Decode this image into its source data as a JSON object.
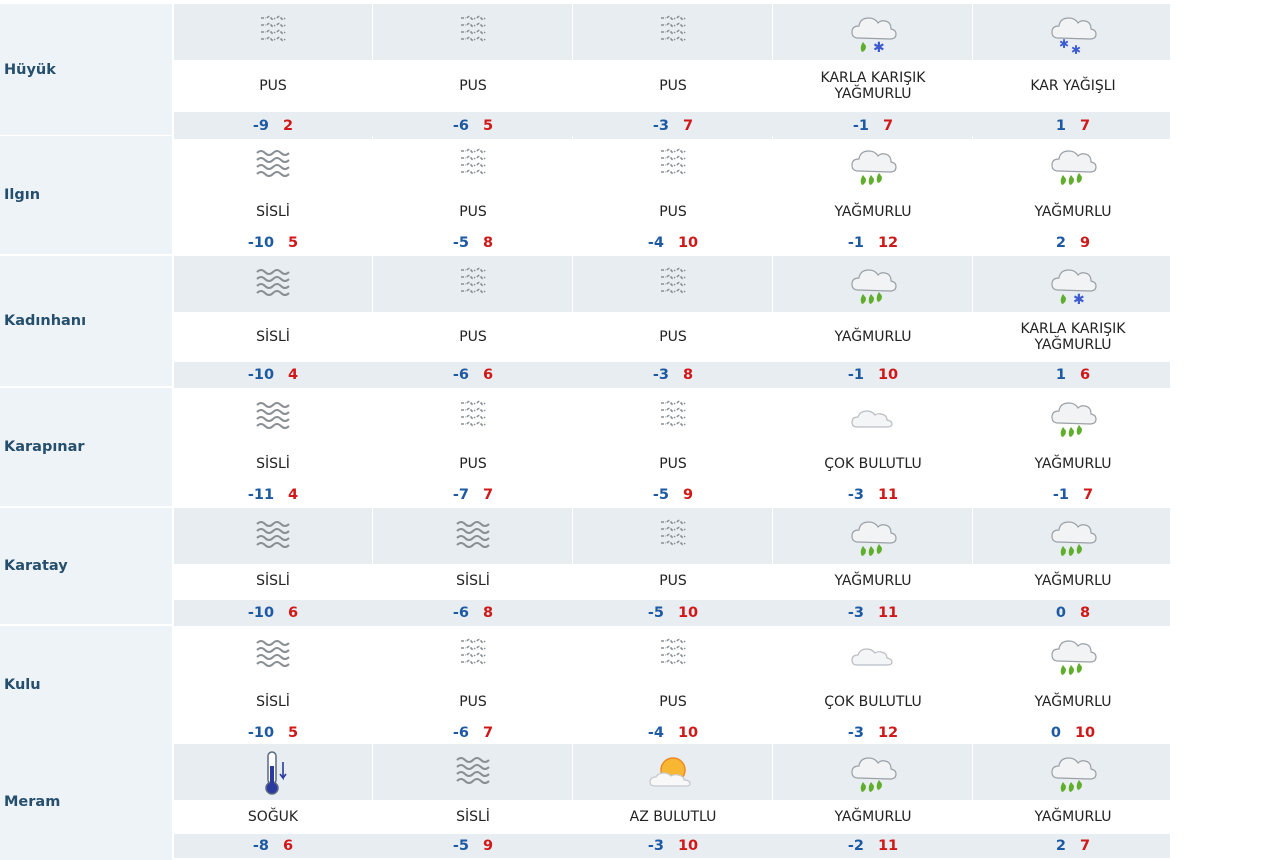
{
  "colors": {
    "name_bg": "#eef3f8",
    "band_bg": "#e8edf2",
    "low_temp": "#1d5aa3",
    "high_temp": "#d01818",
    "rain_drop": "#5fae2c",
    "snow_flake": "#3d5bd1",
    "name_text": "#264f6d"
  },
  "rows": [
    {
      "name": "Hüyük",
      "days": [
        {
          "icon": "fog-haze-icon",
          "cond": "PUS",
          "low": "-9",
          "high": "2"
        },
        {
          "icon": "fog-haze-icon",
          "cond": "PUS",
          "low": "-6",
          "high": "5"
        },
        {
          "icon": "fog-haze-icon",
          "cond": "PUS",
          "low": "-3",
          "high": "7"
        },
        {
          "icon": "sleet-icon",
          "cond": "KARLA KARIŞIK YAĞMURLU",
          "low": "-1",
          "high": "7"
        },
        {
          "icon": "snow-icon",
          "cond": "KAR YAĞIŞLI",
          "low": "1",
          "high": "7"
        }
      ]
    },
    {
      "name": "Ilgın",
      "days": [
        {
          "icon": "fog-waves-icon",
          "cond": "SİSLİ",
          "low": "-10",
          "high": "5"
        },
        {
          "icon": "fog-haze-icon",
          "cond": "PUS",
          "low": "-5",
          "high": "8"
        },
        {
          "icon": "fog-haze-icon",
          "cond": "PUS",
          "low": "-4",
          "high": "10"
        },
        {
          "icon": "rain-icon",
          "cond": "YAĞMURLU",
          "low": "-1",
          "high": "12"
        },
        {
          "icon": "rain-icon",
          "cond": "YAĞMURLU",
          "low": "2",
          "high": "9"
        }
      ]
    },
    {
      "name": "Kadınhanı",
      "days": [
        {
          "icon": "fog-waves-icon",
          "cond": "SİSLİ",
          "low": "-10",
          "high": "4"
        },
        {
          "icon": "fog-haze-icon",
          "cond": "PUS",
          "low": "-6",
          "high": "6"
        },
        {
          "icon": "fog-haze-icon",
          "cond": "PUS",
          "low": "-3",
          "high": "8"
        },
        {
          "icon": "rain-icon",
          "cond": "YAĞMURLU",
          "low": "-1",
          "high": "10"
        },
        {
          "icon": "sleet-icon",
          "cond": "KARLA KARIŞIK YAĞMURLU",
          "low": "1",
          "high": "6"
        }
      ]
    },
    {
      "name": "Karapınar",
      "days": [
        {
          "icon": "fog-waves-icon",
          "cond": "SİSLİ",
          "low": "-11",
          "high": "4"
        },
        {
          "icon": "fog-haze-icon",
          "cond": "PUS",
          "low": "-7",
          "high": "7"
        },
        {
          "icon": "fog-haze-icon",
          "cond": "PUS",
          "low": "-5",
          "high": "9"
        },
        {
          "icon": "cloudy-icon",
          "cond": "ÇOK BULUTLU",
          "low": "-3",
          "high": "11"
        },
        {
          "icon": "rain-icon",
          "cond": "YAĞMURLU",
          "low": "-1",
          "high": "7"
        }
      ]
    },
    {
      "name": "Karatay",
      "days": [
        {
          "icon": "fog-waves-icon",
          "cond": "SİSLİ",
          "low": "-10",
          "high": "6"
        },
        {
          "icon": "fog-waves-icon",
          "cond": "SİSLİ",
          "low": "-6",
          "high": "8"
        },
        {
          "icon": "fog-haze-icon",
          "cond": "PUS",
          "low": "-5",
          "high": "10"
        },
        {
          "icon": "rain-icon",
          "cond": "YAĞMURLU",
          "low": "-3",
          "high": "11"
        },
        {
          "icon": "rain-icon",
          "cond": "YAĞMURLU",
          "low": "0",
          "high": "8"
        }
      ]
    },
    {
      "name": "Kulu",
      "days": [
        {
          "icon": "fog-waves-icon",
          "cond": "SİSLİ",
          "low": "-10",
          "high": "5"
        },
        {
          "icon": "fog-haze-icon",
          "cond": "PUS",
          "low": "-6",
          "high": "7"
        },
        {
          "icon": "fog-haze-icon",
          "cond": "PUS",
          "low": "-4",
          "high": "10"
        },
        {
          "icon": "cloudy-icon",
          "cond": "ÇOK BULUTLU",
          "low": "-3",
          "high": "12"
        },
        {
          "icon": "rain-icon",
          "cond": "YAĞMURLU",
          "low": "0",
          "high": "10"
        }
      ]
    },
    {
      "name": "Meram",
      "days": [
        {
          "icon": "thermometer-cold-icon",
          "cond": "SOĞUK",
          "low": "-8",
          "high": "6"
        },
        {
          "icon": "fog-waves-icon",
          "cond": "SİSLİ",
          "low": "-5",
          "high": "9"
        },
        {
          "icon": "partly-cloudy-sun-icon",
          "cond": "AZ BULUTLU",
          "low": "-3",
          "high": "10"
        },
        {
          "icon": "rain-icon",
          "cond": "YAĞMURLU",
          "low": "-2",
          "high": "11"
        },
        {
          "icon": "rain-icon",
          "cond": "YAĞMURLU",
          "low": "2",
          "high": "7"
        }
      ]
    }
  ]
}
